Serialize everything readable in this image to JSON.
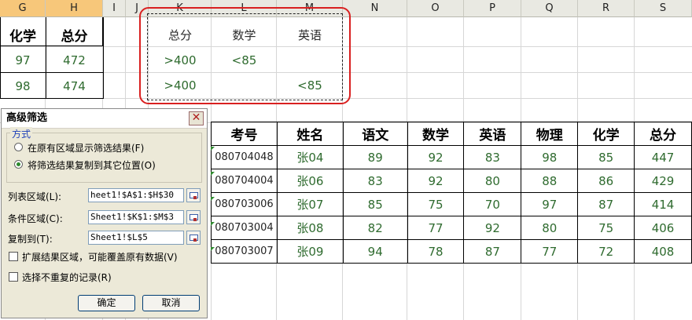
{
  "columns": [
    "G",
    "H",
    "I",
    "J",
    "K",
    "L",
    "M",
    "N",
    "O",
    "P",
    "Q",
    "R",
    "S"
  ],
  "left_table": {
    "headers": [
      "化学",
      "总分"
    ],
    "rows": [
      [
        "97",
        "472"
      ],
      [
        "98",
        "474"
      ]
    ]
  },
  "criteria": {
    "headers": [
      "总分",
      "数学",
      "英语"
    ],
    "rows": [
      [
        ">400",
        "<85",
        ""
      ],
      [
        ">400",
        "",
        "<85"
      ]
    ]
  },
  "result_table": {
    "headers": [
      "考号",
      "姓名",
      "语文",
      "数学",
      "英语",
      "物理",
      "化学",
      "总分"
    ],
    "rows": [
      [
        "080704048",
        "张04",
        "89",
        "92",
        "83",
        "98",
        "85",
        "447"
      ],
      [
        "080704004",
        "张06",
        "83",
        "92",
        "80",
        "88",
        "86",
        "429"
      ],
      [
        "080703006",
        "张07",
        "85",
        "75",
        "70",
        "97",
        "87",
        "414"
      ],
      [
        "080703004",
        "张08",
        "82",
        "77",
        "92",
        "80",
        "75",
        "406"
      ],
      [
        "080703007",
        "张09",
        "94",
        "78",
        "87",
        "77",
        "72",
        "408"
      ]
    ]
  },
  "dialog": {
    "title": "高级筛选",
    "close": "✕",
    "group_label": "方式",
    "radio1": "在原有区域显示筛选结果(F)",
    "radio2": "将筛选结果复制到其它位置(O)",
    "list_label": "列表区域(L):",
    "list_value": "heet1!$A$1:$H$30",
    "criteria_label": "条件区域(C):",
    "criteria_value": "Sheet1!$K$1:$M$3",
    "copy_label": "复制到(T):",
    "copy_value": "Sheet1!$L$5",
    "extend_label": "扩展结果区域，可能覆盖原有数据(V)",
    "unique_label": "选择不重复的记录(R)",
    "ok": "确定",
    "cancel": "取消"
  }
}
